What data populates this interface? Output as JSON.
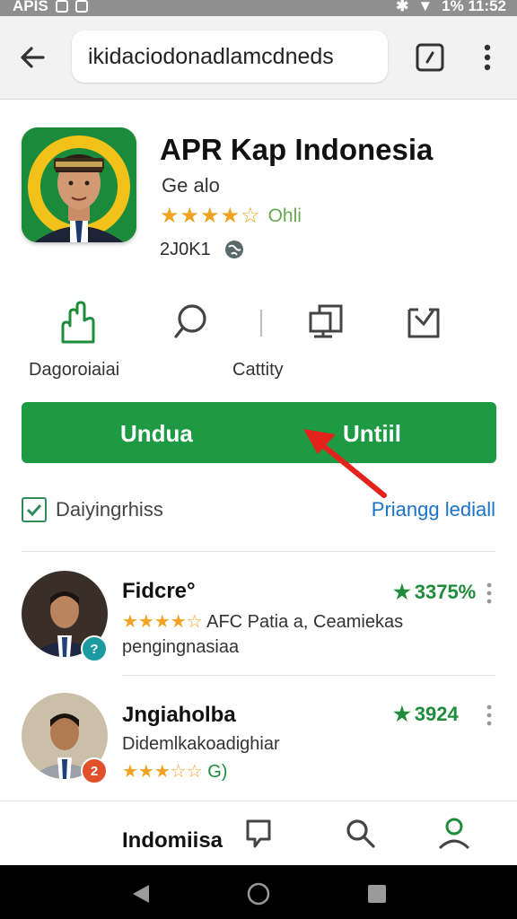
{
  "status_bar": {
    "left_text": "APIS",
    "right_text": "1%  11:52"
  },
  "address_bar": {
    "url": "ikidaciodonadlamcdneds"
  },
  "app": {
    "title": "APR Kap Indonesia",
    "developer": "Ge alo",
    "stars": "★★★★☆",
    "rating_text": "Ohli",
    "size_text": "2J0K1"
  },
  "actions": [
    {
      "label": "Dagoroiaiai",
      "icon": "hand-icon"
    },
    {
      "label": "",
      "icon": "chat-icon"
    },
    {
      "label": "Cattity",
      "icon": "screens-icon"
    },
    {
      "label": "",
      "icon": "download-tray-icon"
    }
  ],
  "install_button": {
    "left_label": "Undua",
    "right_label": "Untiil"
  },
  "check_row": {
    "label": "Daiyingrhiss",
    "link": "Priangg lediall"
  },
  "list": [
    {
      "name": "Fidcre°",
      "score": "3375%",
      "stars": "★★★★☆",
      "sub1": "AFC Patia a, Ceamiekas",
      "sub2": "pengingnasiaa",
      "badge": "?",
      "badge_color": "#1b9aa0"
    },
    {
      "name": "Jngiaholba",
      "score": "3924",
      "stars": "★★★☆☆",
      "sub1": "Didemlkakoadighiar",
      "sub2": "G)",
      "badge": "2",
      "badge_color": "#e0502a"
    },
    {
      "name": "Indomiisa"
    }
  ],
  "colors": {
    "accent": "#1e9a45",
    "link": "#1a73c8",
    "star": "#f0a323"
  }
}
